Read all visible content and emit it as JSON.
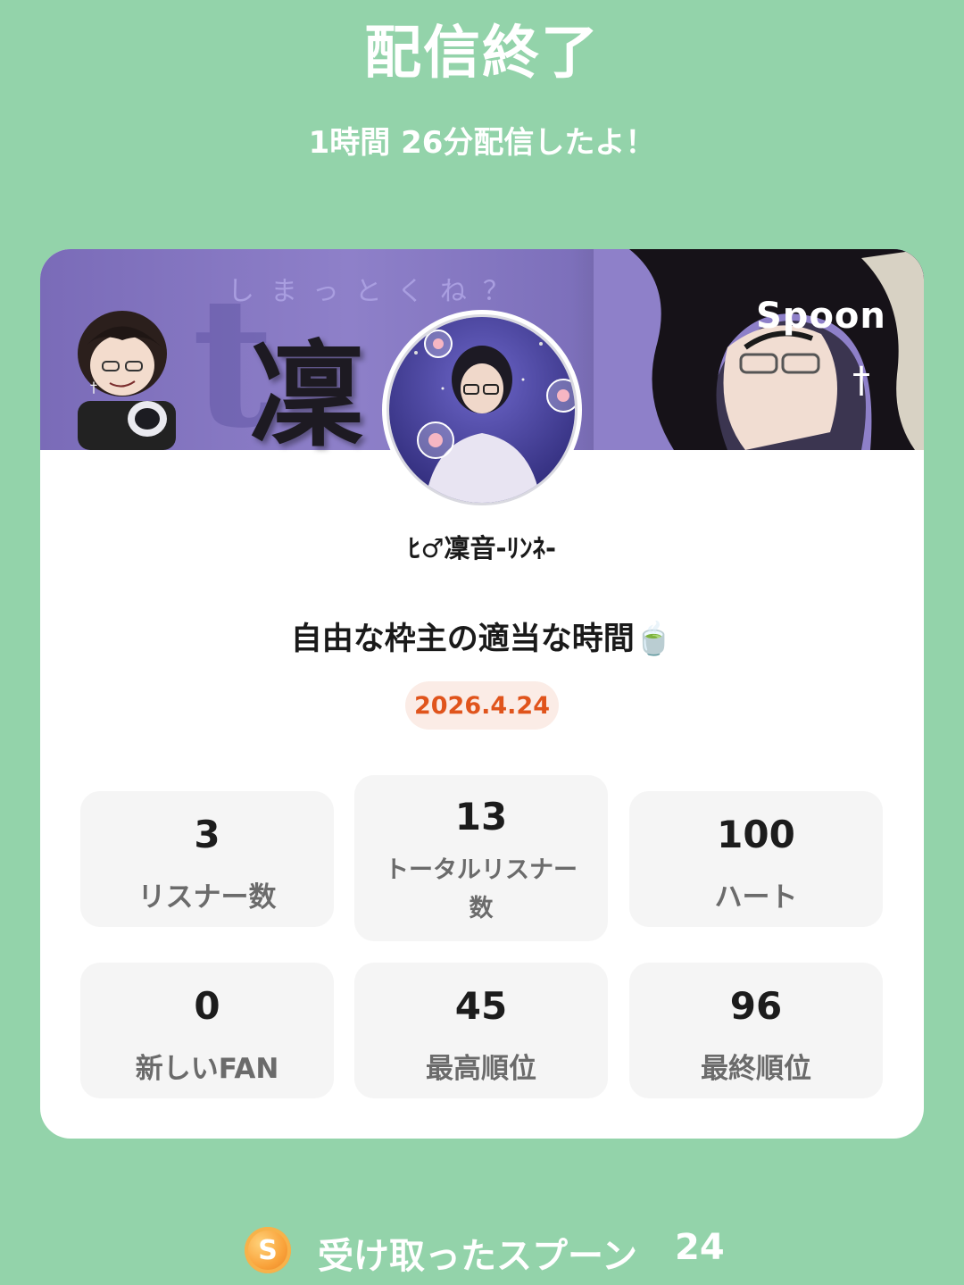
{
  "header": {
    "title": "配信終了",
    "subtitle": "1時間 26分配信したよ！"
  },
  "card": {
    "banner": {
      "kanji": "凜",
      "faint_text": "しまっとくね？",
      "logo": "Spoon"
    },
    "username": "ﾋ♂凜音-ﾘﾝﾈ-",
    "stream_title": "自由な枠主の適当な時間🍵",
    "date": "2026.4.24",
    "stats": [
      {
        "value": "3",
        "label": "リスナー数"
      },
      {
        "value": "13",
        "label": "トータルリスナー数"
      },
      {
        "value": "100",
        "label": "ハート"
      },
      {
        "value": "0",
        "label": "新しいFAN"
      },
      {
        "value": "45",
        "label": "最高順位"
      },
      {
        "value": "96",
        "label": "最終順位"
      }
    ]
  },
  "footer": {
    "coin_letter": "S",
    "label": "受け取ったスプーン",
    "count": "24"
  },
  "colors": {
    "background": "#93d3aa",
    "card": "#ffffff",
    "date_badge_bg": "#fbece6",
    "date_badge_text": "#e0541c",
    "stat_bg": "#f5f5f5",
    "banner_purple": "#7a6bb8"
  }
}
